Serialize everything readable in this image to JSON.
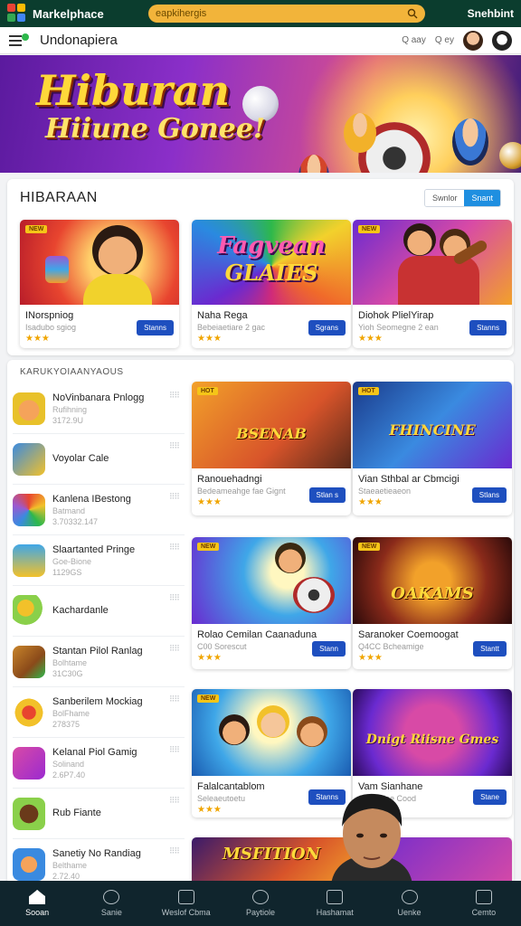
{
  "topbar": {
    "brand": "Markelphace",
    "search_placeholder": "eapkihergis",
    "right_text": "Snehbint"
  },
  "nav": {
    "title": "Undonapiera",
    "search1": "Q aay",
    "search2": "Q ey"
  },
  "banner": {
    "line1": "Hiburan",
    "line2": "Hiiune Gonee!"
  },
  "section1": {
    "title": "HIBARAAN",
    "toggle_off": "Swnlor",
    "toggle_on": "Snant",
    "cards": [
      {
        "title": "INorspniog",
        "sub": "Isadubo sgiog",
        "stars": "★★★",
        "button": "Stanns"
      },
      {
        "title": "Naha Rega",
        "sub": "Bebeiaetiare 2 gac",
        "stars": "★★★",
        "button": "Sgrans",
        "thumb_line1": "Fagvean",
        "thumb_line2": "GLAIES"
      },
      {
        "title": "Diohok PlielYirap",
        "sub": "Yioh Seomegne 2 ean",
        "stars": "★★★",
        "button": "Stanns"
      }
    ]
  },
  "section2": {
    "title": "KARUKYOIAANYAOUS",
    "list": [
      {
        "title": "NoVinbanara Pnlogg",
        "sub1": "Rufihning",
        "sub2": "3172.9U"
      },
      {
        "title": "Voyolar Cale",
        "sub1": "",
        "sub2": ""
      },
      {
        "title": "Kanlena IBestong",
        "sub1": "Batmand",
        "sub2": "3.70332.147"
      },
      {
        "title": "Slaartanted Pringe",
        "sub1": "Goe-Bione",
        "sub2": "1129GS"
      },
      {
        "title": "Kachardanle",
        "sub1": "",
        "sub2": ""
      },
      {
        "title": "Stantan Pilol Ranlag",
        "sub1": "Bolhtame",
        "sub2": "31C30G"
      },
      {
        "title": "Sanberilem Mockiag",
        "sub1": "BolFhame",
        "sub2": "278375"
      },
      {
        "title": "Kelanal Piol Gamig",
        "sub1": "Solinand",
        "sub2": "2.6P7.40"
      },
      {
        "title": "Rub Fiante",
        "sub1": "",
        "sub2": ""
      },
      {
        "title": "Sanetiy No Randiag",
        "sub1": "Belthame",
        "sub2": "2.72.40"
      }
    ],
    "cards": [
      {
        "title": "Ranouehadngi",
        "sub": "Bedeameahge fae Gignt",
        "stars": "★★★",
        "button": "Stlan s",
        "thumb_text": "BSENAB"
      },
      {
        "title": "Vian Sthbal ar Cbmcigi",
        "sub": "Staeaetieaeon",
        "stars": "★★★",
        "button": "Stlans",
        "thumb_text": "FHINCINE"
      },
      {
        "title": "Rolao Cemilan Caanaduna",
        "sub": "C00 Sorescut",
        "stars": "★★★",
        "button": "Stann"
      },
      {
        "title": "Saranoker Coemoogat",
        "sub": "Q4CC Bcheamige",
        "stars": "★★★",
        "button": "Stantt",
        "thumb_text": "OAKAMS"
      },
      {
        "title": "Falalcantablom",
        "sub": "Seleaeutoetu",
        "stars": "★★★",
        "button": "Stanns"
      },
      {
        "title": "Vam Sianhane",
        "sub": "Sooeaiiee Cood",
        "stars": "",
        "button": "Stane",
        "thumb_text": "Dnigt Riisne Gmes"
      },
      {
        "title": "",
        "sub": "",
        "stars": "",
        "button": "",
        "thumb_text": "MSFITION"
      }
    ]
  },
  "bottomnav": [
    {
      "label": "Sooan",
      "icon": "home-icon"
    },
    {
      "label": "Sanie",
      "icon": "compass-icon"
    },
    {
      "label": "Weslof Cbma",
      "icon": "grid-icon"
    },
    {
      "label": "Paytiole",
      "icon": "circle-icon"
    },
    {
      "label": "Hashamat",
      "icon": "square-icon"
    },
    {
      "label": "Uenke",
      "icon": "search-icon"
    },
    {
      "label": "Cemto",
      "icon": "monitor-icon"
    }
  ]
}
